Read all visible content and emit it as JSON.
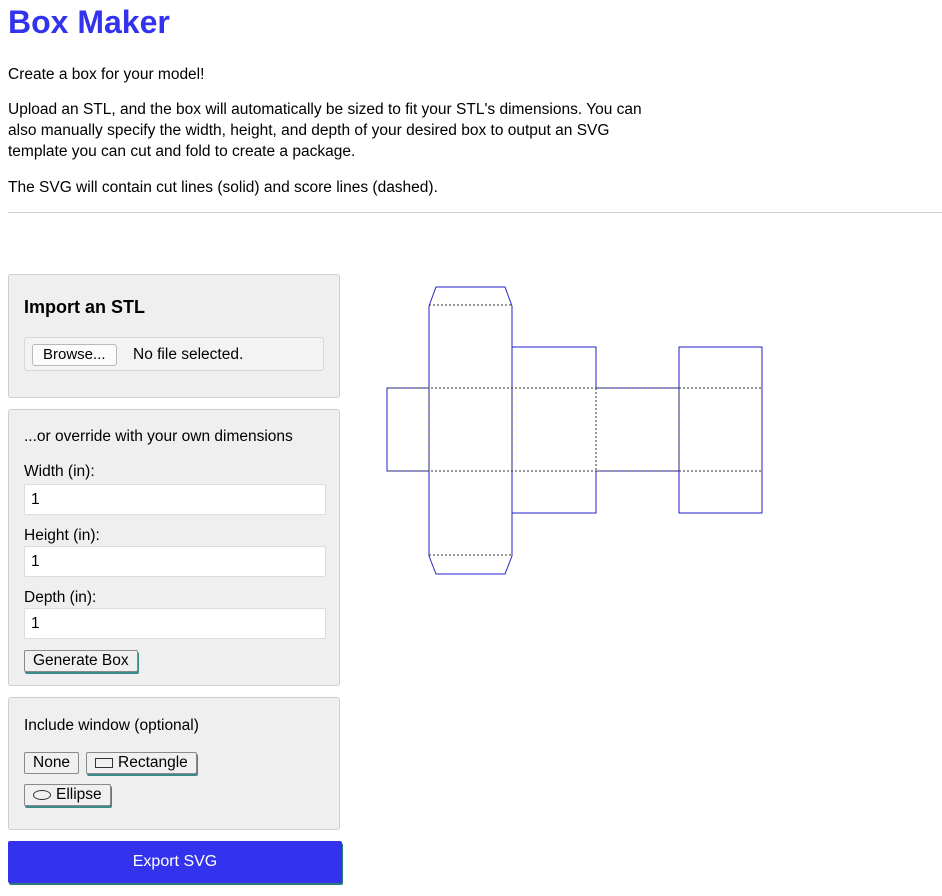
{
  "app": {
    "title": "Box Maker"
  },
  "intro": {
    "line1": "Create a box for your model!",
    "line2": "Upload an STL, and the box will automatically be sized to fit your STL's dimensions. You can also manually specify the width, height, and depth of your desired box to output an SVG template you can cut and fold to create a package.",
    "line3": "The SVG will contain cut lines (solid) and score lines (dashed)."
  },
  "import": {
    "title": "Import an STL",
    "browse_label": "Browse...",
    "file_status": "No file selected."
  },
  "dimensions": {
    "heading": "...or override with your own dimensions",
    "width_label": "Width (in):",
    "width_value": "1",
    "height_label": "Height (in):",
    "height_value": "1",
    "depth_label": "Depth (in):",
    "depth_value": "1",
    "generate_label": "Generate Box"
  },
  "window": {
    "heading": "Include window (optional)",
    "none_label": "None",
    "rectangle_label": "Rectangle",
    "ellipse_label": "Ellipse"
  },
  "export": {
    "label": "Export SVG"
  },
  "colors": {
    "accent": "#3333ee",
    "cut_line": "#2222cc",
    "score_line": "#333333",
    "panel_bg": "#efefef"
  },
  "icons": {
    "rectangle": "rectangle-outline-icon",
    "ellipse": "ellipse-outline-icon"
  }
}
